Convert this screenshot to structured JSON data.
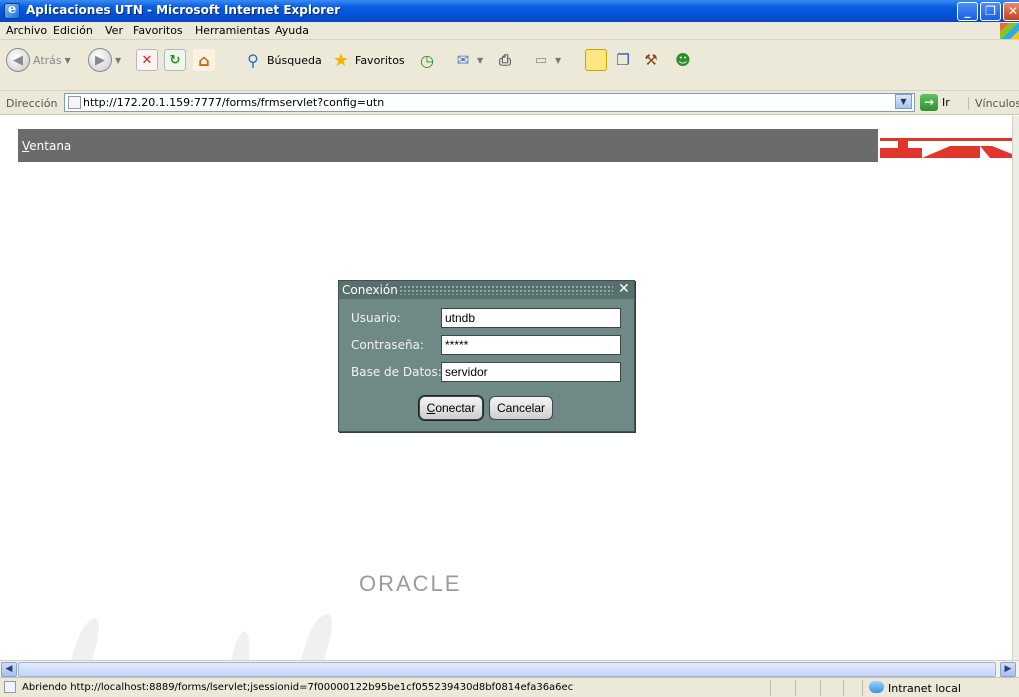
{
  "window": {
    "title": "Aplicaciones UTN - Microsoft Internet Explorer"
  },
  "menu": {
    "items": [
      "Archivo",
      "Edición",
      "Ver",
      "Favoritos",
      "Herramientas",
      "Ayuda"
    ]
  },
  "toolbar": {
    "back_label": "Atrás",
    "search_label": "Búsqueda",
    "favorites_label": "Favoritos"
  },
  "address": {
    "label": "Dirección",
    "url": "http://172.20.1.159:7777/forms/frmservlet?config=utn",
    "go_label": "Ir",
    "links_label": "Vínculos"
  },
  "page": {
    "window_menu_label": "Ventana",
    "oracle_logo": "ORACLE"
  },
  "dialog": {
    "title": "Conexión",
    "close_symbol": "✕",
    "fields": [
      {
        "label": "Usuario:",
        "value": "utndb"
      },
      {
        "label": "Contraseña:",
        "value": "*****"
      },
      {
        "label": "Base de Datos:",
        "value": "servidor"
      }
    ],
    "connect_label": "Conectar",
    "cancel_label": "Cancelar"
  },
  "status": {
    "text": "Abriendo http://localhost:8889/forms/lservlet;jsessionid=7f00000122b95be1cf055239430d8bf0814efa36a6ec",
    "zone": "Intranet local"
  },
  "colors": {
    "titlebar": "#0a5fe0",
    "dialog_bg": "#6f8a86",
    "ventana_bar": "#6b6b6b",
    "utn_red": "#e0362b"
  }
}
